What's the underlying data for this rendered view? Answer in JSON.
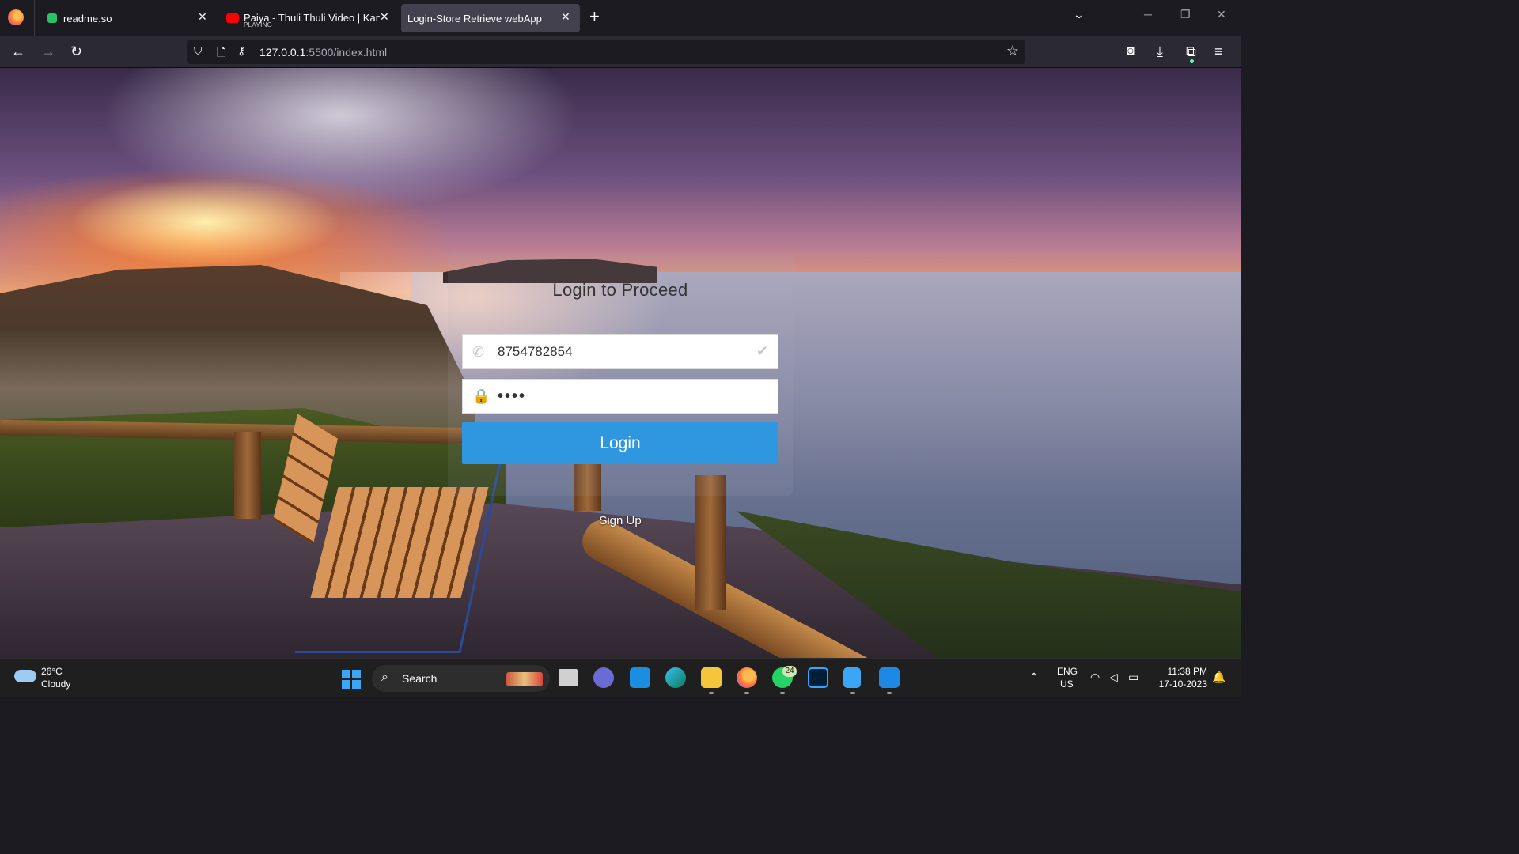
{
  "browser": {
    "tabs": [
      {
        "title": "readme.so",
        "subtitle": ""
      },
      {
        "title": "Paiya - Thuli Thuli Video | Karthi",
        "subtitle": "PLAYING"
      },
      {
        "title": "Login-Store Retrieve webApp",
        "subtitle": ""
      }
    ],
    "tab_close_glyph": "✕",
    "new_tab_glyph": "+",
    "url_host": "127.0.0.1",
    "url_path": ":5500/index.html"
  },
  "page": {
    "title": "Login to Proceed",
    "phone": {
      "value": "8754782854",
      "icon": "phone-icon",
      "valid_icon": "check-icon"
    },
    "password": {
      "value": "1234",
      "icon": "lock-icon"
    },
    "login_label": "Login",
    "signup_label": "Sign Up",
    "accent_color": "#2f96e0"
  },
  "taskbar": {
    "weather": {
      "temp": "26°C",
      "desc": "Cloudy"
    },
    "search_label": "Search",
    "notification_badge": "24",
    "lang": {
      "line1": "ENG",
      "line2": "US"
    },
    "clock": {
      "time": "11:38 PM",
      "date": "17-10-2023"
    }
  }
}
